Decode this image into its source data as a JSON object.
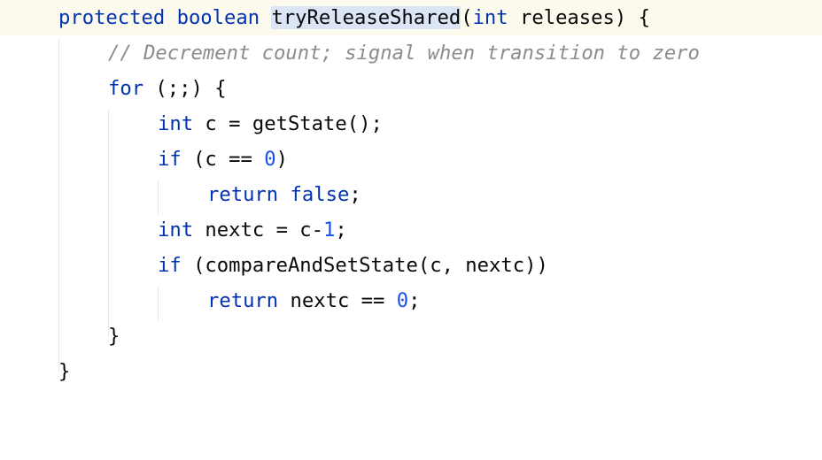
{
  "editor": {
    "lines": [
      {
        "tokens": [
          {
            "t": "protected",
            "c": "kw"
          },
          {
            "t": " "
          },
          {
            "t": "boolean",
            "c": "kw"
          },
          {
            "t": " "
          },
          {
            "t": "",
            "c": "caret"
          },
          {
            "t": "tryReleaseShared",
            "c": "hl"
          },
          {
            "t": "("
          },
          {
            "t": "int",
            "c": "kw"
          },
          {
            "t": " releases) {"
          }
        ]
      },
      {
        "tokens": [
          {
            "t": "// Decrement count; signal when transition to zero",
            "c": "cmt"
          }
        ]
      },
      {
        "tokens": [
          {
            "t": "for",
            "c": "kw"
          },
          {
            "t": " (;;) {"
          }
        ]
      },
      {
        "tokens": [
          {
            "t": "int",
            "c": "kw"
          },
          {
            "t": " c = getState();"
          }
        ]
      },
      {
        "tokens": [
          {
            "t": "if",
            "c": "kw"
          },
          {
            "t": " (c == "
          },
          {
            "t": "0",
            "c": "num"
          },
          {
            "t": ")"
          }
        ]
      },
      {
        "tokens": [
          {
            "t": "return",
            "c": "kw"
          },
          {
            "t": " "
          },
          {
            "t": "false",
            "c": "kw"
          },
          {
            "t": ";"
          }
        ]
      },
      {
        "tokens": [
          {
            "t": "int",
            "c": "kw"
          },
          {
            "t": " nextc = c-"
          },
          {
            "t": "1",
            "c": "num"
          },
          {
            "t": ";"
          }
        ]
      },
      {
        "tokens": [
          {
            "t": "if",
            "c": "kw"
          },
          {
            "t": " (compareAndSetState(c, nextc))"
          }
        ]
      },
      {
        "tokens": [
          {
            "t": "return",
            "c": "kw"
          },
          {
            "t": " nextc == "
          },
          {
            "t": "0",
            "c": "num"
          },
          {
            "t": ";"
          }
        ]
      },
      {
        "tokens": [
          {
            "t": "}"
          }
        ]
      },
      {
        "tokens": [
          {
            "t": "}"
          }
        ]
      }
    ]
  },
  "colors": {
    "keyword": "#0033b3",
    "number": "#1750eb",
    "comment": "#8c8c8c",
    "text": "#080808",
    "identifier_highlight": "#dbe5f5",
    "current_line": "#fcfaed",
    "indent_guide": "#e6e6e6"
  }
}
